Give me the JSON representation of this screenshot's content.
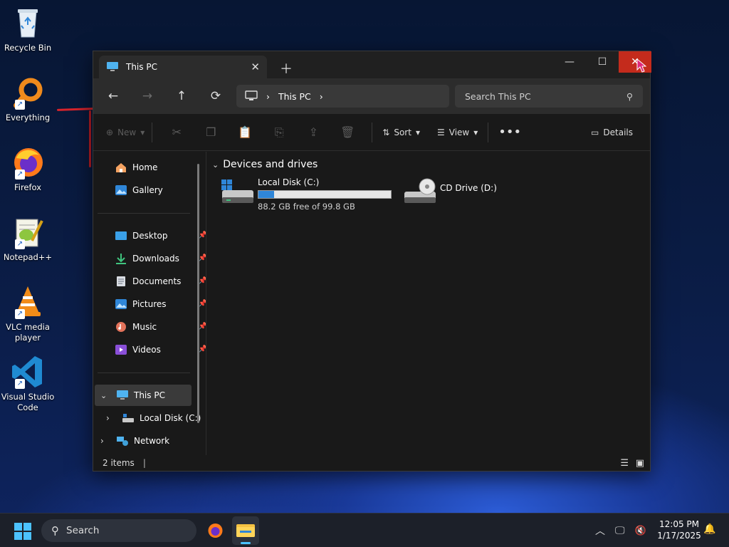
{
  "desktop": {
    "icons": [
      {
        "label": "Recycle Bin"
      },
      {
        "label": "Everything"
      },
      {
        "label": "Firefox"
      },
      {
        "label": "Notepad++"
      },
      {
        "label": "VLC media player"
      },
      {
        "label": "Visual Studio Code"
      }
    ]
  },
  "window": {
    "tab_title": "This PC",
    "address": {
      "segments": [
        "This PC"
      ]
    },
    "search_placeholder": "Search This PC",
    "commands": {
      "new_label": "New",
      "sort_label": "Sort",
      "view_label": "View",
      "details_label": "Details"
    },
    "sidebar": {
      "quick": [
        {
          "label": "Home"
        },
        {
          "label": "Gallery"
        }
      ],
      "pinned": [
        {
          "label": "Desktop"
        },
        {
          "label": "Downloads"
        },
        {
          "label": "Documents"
        },
        {
          "label": "Pictures"
        },
        {
          "label": "Music"
        },
        {
          "label": "Videos"
        }
      ],
      "tree": [
        {
          "label": "This PC",
          "selected": true
        },
        {
          "label": "Local Disk (C:)"
        },
        {
          "label": "Network"
        }
      ]
    },
    "content": {
      "group_header": "Devices and drives",
      "drives": [
        {
          "name": "Local Disk (C:)",
          "free_text": "88.2 GB free of 99.8 GB",
          "used_fraction": 0.116
        },
        {
          "name": "CD Drive (D:)"
        }
      ]
    },
    "status": {
      "item_count": "2 items"
    }
  },
  "taskbar": {
    "search_label": "Search",
    "time": "12:05 PM",
    "date": "1/17/2025"
  },
  "colors": {
    "accent": "#2f86d8",
    "close_red": "#c42b1c",
    "selected_bg": "#3a3a3a"
  }
}
